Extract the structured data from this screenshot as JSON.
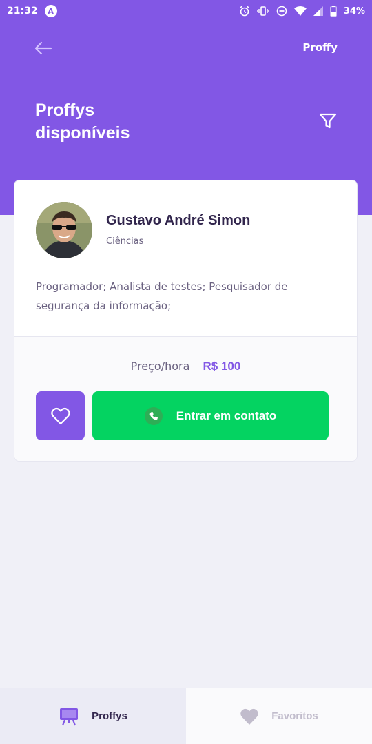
{
  "status_bar": {
    "time": "21:32",
    "app_badge": "A",
    "battery_percent": "34%",
    "icons": [
      "alarm-icon",
      "vibrate-icon",
      "do-not-disturb-icon",
      "wifi-icon",
      "signal-icon",
      "battery-icon"
    ]
  },
  "header": {
    "brand": "Proffy",
    "title_line1": "Proffys",
    "title_line2": "disponíveis",
    "back_icon": "arrow-left-icon",
    "filter_icon": "filter-icon"
  },
  "teacher": {
    "name": "Gustavo André Simon",
    "subject": "Ciências",
    "bio": "Programador; Analista de testes; Pesquisador de segurança da informação;",
    "price_label": "Preço/hora",
    "price_value": "R$ 100",
    "contact_label": "Entrar em contato"
  },
  "tabs": [
    {
      "label": "Proffys",
      "icon": "easel-icon",
      "active": true
    },
    {
      "label": "Favoritos",
      "icon": "heart-icon",
      "active": false
    }
  ],
  "colors": {
    "primary": "#8257e5",
    "secondary": "#04d361",
    "background": "#f0f0f7",
    "title": "#32264d",
    "text": "#6a6180"
  }
}
